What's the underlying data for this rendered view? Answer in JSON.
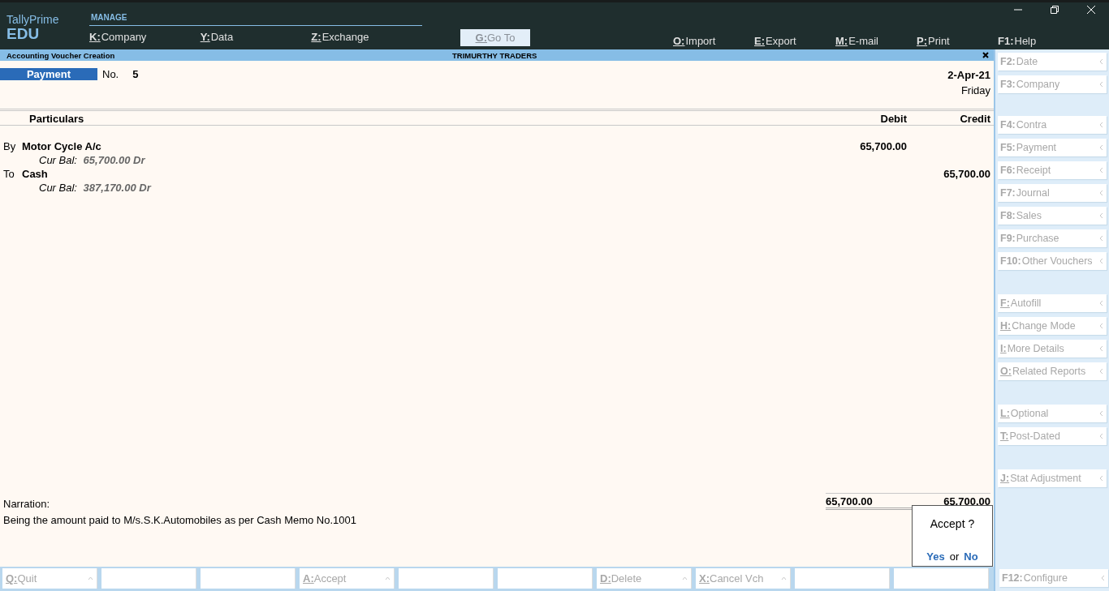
{
  "app": {
    "name": "TallyPrime",
    "edition": "EDU"
  },
  "menu": {
    "heading": "MANAGE",
    "left": [
      {
        "key": "K:",
        "label": "Company"
      },
      {
        "key": "Y:",
        "label": "Data"
      },
      {
        "key": "Z:",
        "label": "Exchange"
      }
    ],
    "goto": {
      "key": "G:",
      "label": "Go To",
      "disabled": true
    },
    "right": [
      {
        "key": "O:",
        "label": "Import",
        "underlined": true
      },
      {
        "key": "E:",
        "label": "Export",
        "underlined": true
      },
      {
        "key": "M:",
        "label": "E-mail",
        "underlined": true
      },
      {
        "key": "P:",
        "label": "Print",
        "underlined": true
      },
      {
        "key": "F1:",
        "label": "Help",
        "underlined": false
      }
    ]
  },
  "window": {
    "title": "Accounting Voucher Creation",
    "company": "TRIMURTHY TRADERS"
  },
  "voucher": {
    "type": "Payment",
    "number_label": "No.",
    "number": "5",
    "date": "2-Apr-21",
    "day": "Friday"
  },
  "table": {
    "columns": [
      "Particulars",
      "Debit",
      "Credit"
    ],
    "rows": [
      {
        "prefix": "By",
        "ledger": "Motor Cycle A/c",
        "balance_label": "Cur Bal:",
        "balance": "65,700.00 Dr",
        "debit": "65,700.00"
      },
      {
        "prefix": "To",
        "ledger": "Cash",
        "balance_label": "Cur Bal:",
        "balance": "387,170.00 Dr",
        "credit": "65,700.00"
      }
    ],
    "total_debit": "65,700.00",
    "total_credit": "65,700.00"
  },
  "narration": {
    "label": "Narration:",
    "text": "Being the amount paid to M/s.S.K.Automobiles as per Cash Memo No.1001"
  },
  "dialog": {
    "question": "Accept ?",
    "yes": "Yes",
    "or": "or",
    "no": "No"
  },
  "side_groups": [
    [
      {
        "key": "F2:",
        "label": "Date",
        "underlined": false
      },
      {
        "key": "F3:",
        "label": "Company",
        "underlined": false
      }
    ],
    [
      {
        "key": "F4:",
        "label": "Contra",
        "underlined": false
      },
      {
        "key": "F5:",
        "label": "Payment",
        "underlined": false
      },
      {
        "key": "F6:",
        "label": "Receipt",
        "underlined": false
      },
      {
        "key": "F7:",
        "label": "Journal",
        "underlined": false
      },
      {
        "key": "F8:",
        "label": "Sales",
        "underlined": false
      },
      {
        "key": "F9:",
        "label": "Purchase",
        "underlined": false
      },
      {
        "key": "F10:",
        "label": "Other Vouchers",
        "underlined": false
      }
    ],
    [
      {
        "key": "F:",
        "label": "Autofill",
        "underlined": true
      },
      {
        "key": "H:",
        "label": "Change Mode",
        "underlined": true
      },
      {
        "key": "I:",
        "label": "More Details",
        "underlined": true
      },
      {
        "key": "O:",
        "label": "Related Reports",
        "underlined": true
      }
    ],
    [
      {
        "key": "L:",
        "label": "Optional",
        "underlined": true
      },
      {
        "key": "T:",
        "label": "Post-Dated",
        "underlined": true
      }
    ],
    [
      {
        "key": "J:",
        "label": "Stat Adjustment",
        "underlined": true
      }
    ]
  ],
  "side_bottom": {
    "key": "F12:",
    "label": "Configure",
    "underlined": false
  },
  "bottom_bar": [
    {
      "kind": "action",
      "key": "Q:",
      "label": "Quit"
    },
    {
      "kind": "blank"
    },
    {
      "kind": "blank"
    },
    {
      "kind": "action",
      "key": "A:",
      "label": "Accept"
    },
    {
      "kind": "blank"
    },
    {
      "kind": "blank"
    },
    {
      "kind": "action",
      "key": "D:",
      "label": "Delete"
    },
    {
      "kind": "action",
      "key": "X:",
      "label": "Cancel Vch"
    },
    {
      "kind": "blank"
    },
    {
      "kind": "blank"
    }
  ]
}
